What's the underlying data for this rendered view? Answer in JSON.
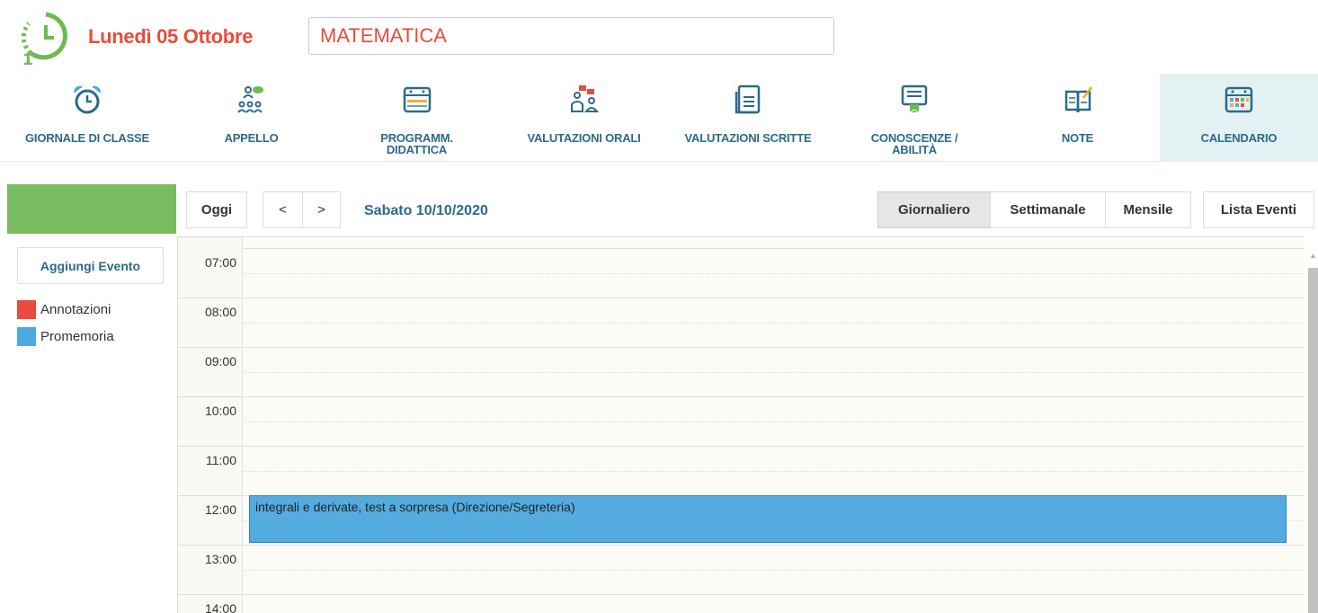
{
  "header": {
    "date_title": "Lunedì 05 Ottobre",
    "subject_value": "MATEMATICA",
    "logo_text": "1°"
  },
  "nav": {
    "items": [
      {
        "label": "GIORNALE DI CLASSE",
        "icon": "alarm-clock-icon"
      },
      {
        "label": "APPELLO",
        "icon": "attendance-group-icon"
      },
      {
        "label": "PROGRAMM.\nDIDATTICA",
        "icon": "calendar-plan-icon"
      },
      {
        "label": "VALUTAZIONI ORALI",
        "icon": "oral-grades-icon"
      },
      {
        "label": "VALUTAZIONI SCRITTE",
        "icon": "written-grades-icon"
      },
      {
        "label": "CONOSCENZE /\nABILITÀ",
        "icon": "skills-certificate-icon"
      },
      {
        "label": "NOTE",
        "icon": "notes-book-icon"
      },
      {
        "label": "CALENDARIO",
        "icon": "calendar-icon"
      }
    ],
    "active": "CALENDARIO"
  },
  "sidebar": {
    "add_event_label": "Aggiungi Evento",
    "legend": [
      {
        "label": "Annotazioni",
        "color": "#e74c3c"
      },
      {
        "label": "Promemoria",
        "color": "#4eaadf"
      }
    ]
  },
  "toolbar": {
    "today_label": "Oggi",
    "prev_label": "<",
    "next_label": ">",
    "current_date": "Sabato 10/10/2020",
    "views": [
      "Giornaliero",
      "Settimanale",
      "Mensile"
    ],
    "active_view": "Giornaliero",
    "list_label": "Lista Eventi"
  },
  "calendar": {
    "hours": [
      "07:00",
      "08:00",
      "09:00",
      "10:00",
      "11:00",
      "12:00",
      "13:00",
      "14:00"
    ],
    "events": [
      {
        "title": "integrali e derivate, test a sorpresa (Direzione/Segreteria)",
        "start": "12:00",
        "end": "13:00",
        "category": "Promemoria"
      }
    ]
  },
  "colors": {
    "accent_red": "#e74c3c",
    "nav_blue": "#2a6b8a",
    "green_bar": "#77bc5e",
    "event_blue": "#54abe0",
    "active_nav_bg": "#e4f1f2"
  }
}
